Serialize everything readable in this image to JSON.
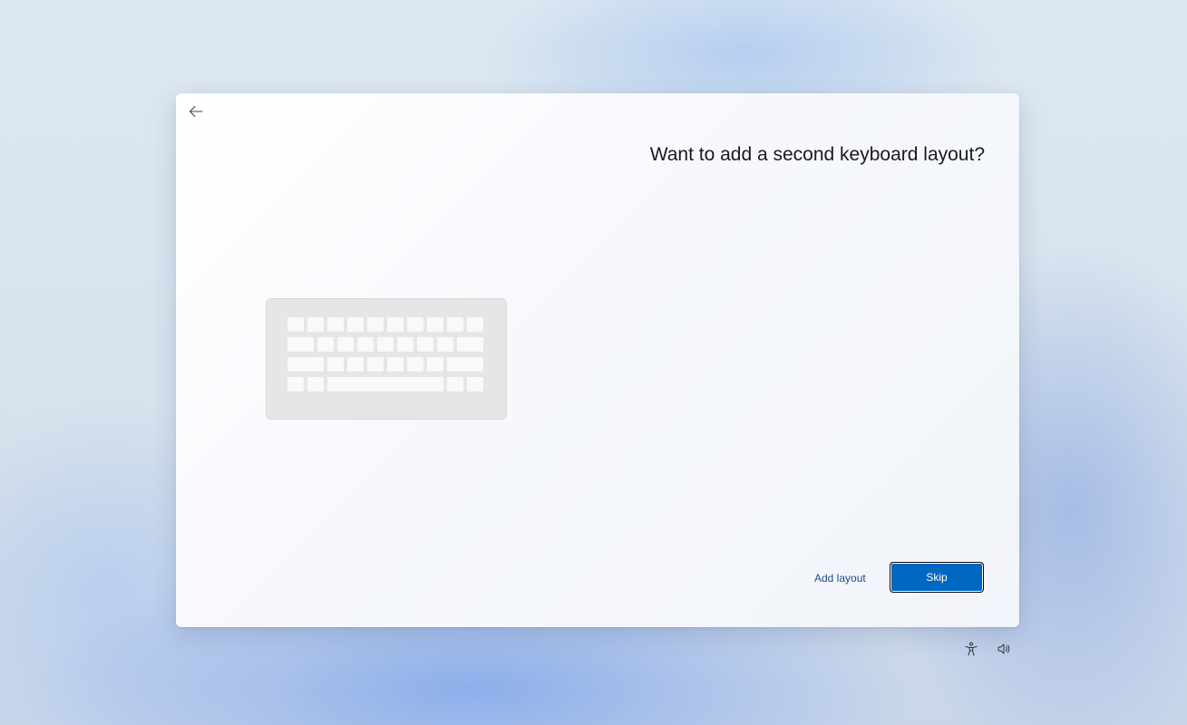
{
  "dialog": {
    "title": "Want to add a second keyboard layout?",
    "back_icon": "back-arrow-icon",
    "illustration_icon": "keyboard-icon",
    "buttons": {
      "add_layout_label": "Add layout",
      "skip_label": "Skip"
    }
  },
  "tray": {
    "icons": [
      "accessibility-icon",
      "volume-icon"
    ]
  },
  "colors": {
    "accent": "#0067c0",
    "link": "#1e4e8c",
    "title_text": "#1a1a1a"
  }
}
